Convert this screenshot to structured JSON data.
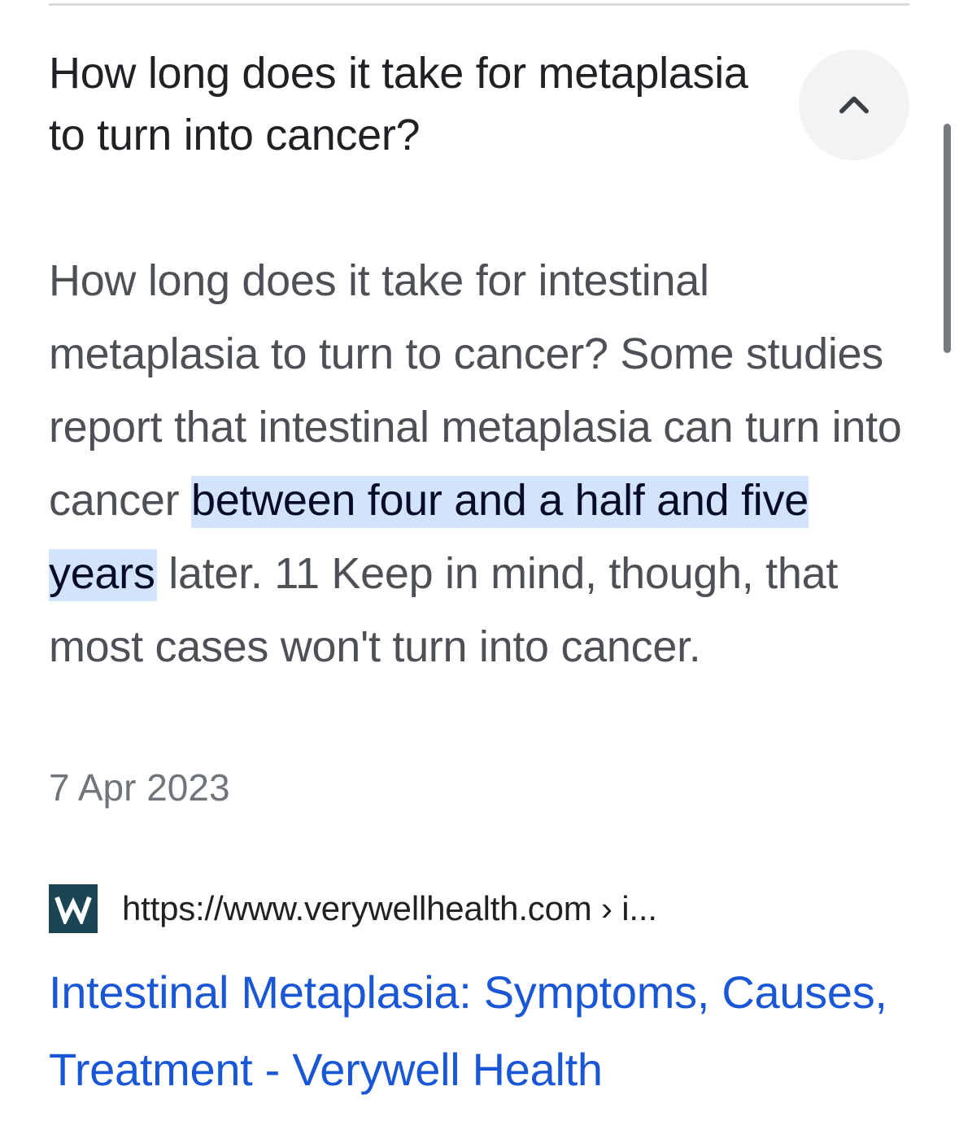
{
  "question": {
    "text": "How long does it take for metaplasia to turn into cancer?",
    "collapse_icon": "chevron-up-icon"
  },
  "answer": {
    "text_before": "How long does it take for intestinal metaplasia to turn to cancer? Some studies report that intestinal metaplasia can turn into cancer ",
    "highlight": "between four and a half and five years",
    "text_after": " later. 11 Keep in mind, though, that most cases won't turn into cancer."
  },
  "date": "7 Apr 2023",
  "source": {
    "favicon_icon": "verywell-logo-icon",
    "favicon_color": "#1b4552",
    "url": "https://www.verywellhealth.com › i..."
  },
  "result": {
    "title": "Intestinal Metaplasia: Symptoms, Causes, Treatment - Verywell Health",
    "link_color": "#1a57d6"
  },
  "colors": {
    "highlight_bg": "#d3e3fd",
    "question_text": "#202124",
    "answer_text": "#4d5156"
  }
}
